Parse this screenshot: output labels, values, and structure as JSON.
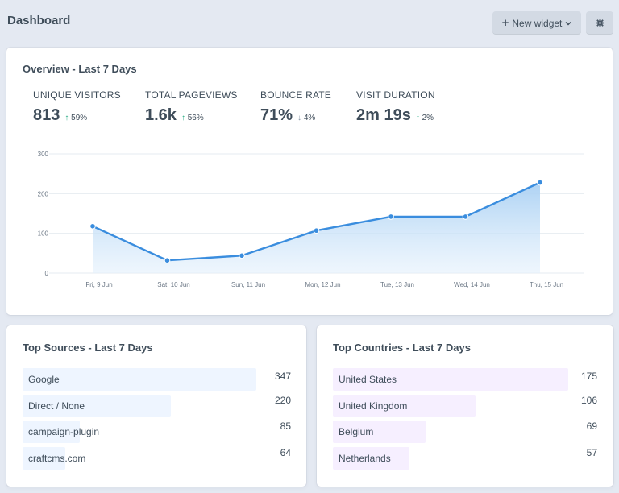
{
  "header": {
    "title": "Dashboard",
    "new_widget_label": "New widget",
    "plus_icon": "plus-icon",
    "chevron_icon": "chevron-down-icon",
    "settings_icon": "gear-icon"
  },
  "overview": {
    "title": "Overview - Last 7 Days",
    "metrics": [
      {
        "label": "UNIQUE VISITORS",
        "value": "813",
        "change": "59%",
        "direction": "up"
      },
      {
        "label": "TOTAL PAGEVIEWS",
        "value": "1.6k",
        "change": "56%",
        "direction": "up"
      },
      {
        "label": "BOUNCE RATE",
        "value": "71%",
        "change": "4%",
        "direction": "down"
      },
      {
        "label": "VISIT DURATION",
        "value": "2m 19s",
        "change": "2%",
        "direction": "up"
      }
    ]
  },
  "chart_data": {
    "type": "area",
    "categories": [
      "Fri, 9 Jun",
      "Sat, 10 Jun",
      "Sun, 11 Jun",
      "Mon, 12 Jun",
      "Tue, 13 Jun",
      "Wed, 14 Jun",
      "Thu, 15 Jun"
    ],
    "values": [
      118,
      32,
      44,
      107,
      142,
      142,
      228
    ],
    "yticks": [
      0,
      100,
      200,
      300
    ],
    "ylim": [
      0,
      300
    ],
    "grid": true,
    "line_color": "#3a8dde",
    "fill_color": "#c5e0f7"
  },
  "sources": {
    "title": "Top Sources - Last 7 Days",
    "bar_color": "#eef5ff",
    "max": 347,
    "items": [
      {
        "label": "Google",
        "value": "347",
        "amount": 347
      },
      {
        "label": "Direct / None",
        "value": "220",
        "amount": 220
      },
      {
        "label": "campaign-plugin",
        "value": "85",
        "amount": 85
      },
      {
        "label": "craftcms.com",
        "value": "64",
        "amount": 64
      }
    ]
  },
  "countries": {
    "title": "Top Countries - Last 7 Days",
    "bar_color": "#f6efff",
    "max": 175,
    "items": [
      {
        "label": "United States",
        "value": "175",
        "amount": 175
      },
      {
        "label": "United Kingdom",
        "value": "106",
        "amount": 106
      },
      {
        "label": "Belgium",
        "value": "69",
        "amount": 69
      },
      {
        "label": "Netherlands",
        "value": "57",
        "amount": 57
      }
    ]
  }
}
